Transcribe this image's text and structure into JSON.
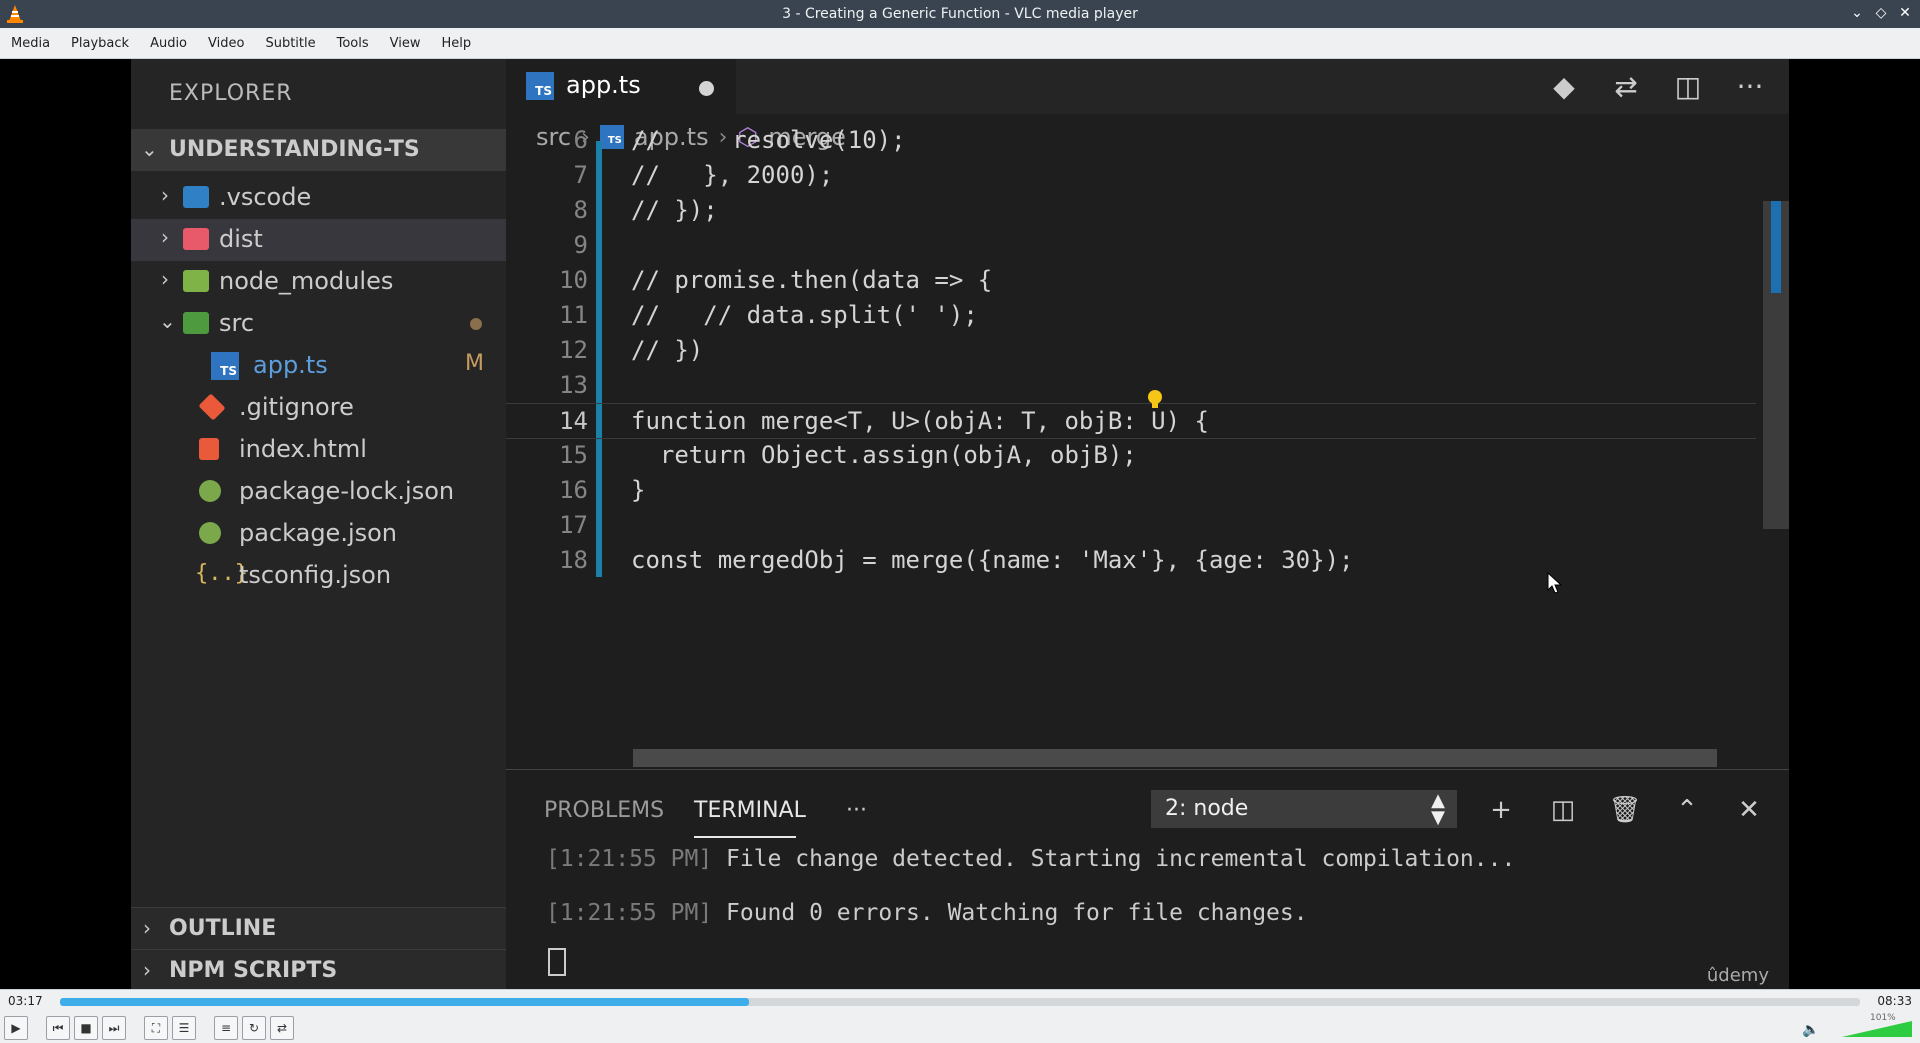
{
  "window": {
    "title": "3 - Creating a Generic Function - VLC media player"
  },
  "menu": [
    "Media",
    "Playback",
    "Audio",
    "Video",
    "Subtitle",
    "Tools",
    "View",
    "Help"
  ],
  "explorer": {
    "title": "EXPLORER",
    "project": "UNDERSTANDING-TS",
    "items": [
      {
        "label": ".vscode"
      },
      {
        "label": "dist"
      },
      {
        "label": "node_modules"
      },
      {
        "label": "src"
      },
      {
        "label": "app.ts",
        "status": "M"
      },
      {
        "label": ".gitignore"
      },
      {
        "label": "index.html"
      },
      {
        "label": "package-lock.json"
      },
      {
        "label": "package.json"
      },
      {
        "label": "tsconfig.json"
      }
    ],
    "outline": "OUTLINE",
    "npm_scripts": "NPM SCRIPTS"
  },
  "editor": {
    "tab_label": "app.ts",
    "breadcrumb": [
      "src",
      "app.ts",
      "merge"
    ],
    "lines": [
      {
        "num": "6",
        "text": "//     resolve(10);"
      },
      {
        "num": "7",
        "text": "//   }, 2000);"
      },
      {
        "num": "8",
        "text": "// });"
      },
      {
        "num": "9",
        "text": ""
      },
      {
        "num": "10",
        "text": "// promise.then(data => {"
      },
      {
        "num": "11",
        "text": "//   // data.split(' ');"
      },
      {
        "num": "12",
        "text": "// })"
      },
      {
        "num": "13",
        "text": ""
      },
      {
        "num": "14",
        "text": "function merge<T, U>(objA: T, objB: U) {"
      },
      {
        "num": "15",
        "text": "  return Object.assign(objA, objB);"
      },
      {
        "num": "16",
        "text": "}"
      },
      {
        "num": "17",
        "text": ""
      },
      {
        "num": "18",
        "text": "const mergedObj = merge({name: 'Max'}, {age: 30});"
      }
    ]
  },
  "panel": {
    "tabs": [
      "PROBLEMS",
      "TERMINAL"
    ],
    "more": "···",
    "terminal_select": "2: node",
    "output": [
      {
        "time": "[1:21:55 PM]",
        "text": " File change detected. Starting incremental compilation..."
      },
      {
        "time": "[1:21:55 PM]",
        "text": " Found 0 errors. Watching for file changes."
      }
    ]
  },
  "watermark": "ûdemy",
  "player": {
    "elapsed": "03:17",
    "total": "08:33",
    "progress": 0.383,
    "volume": "101%"
  }
}
